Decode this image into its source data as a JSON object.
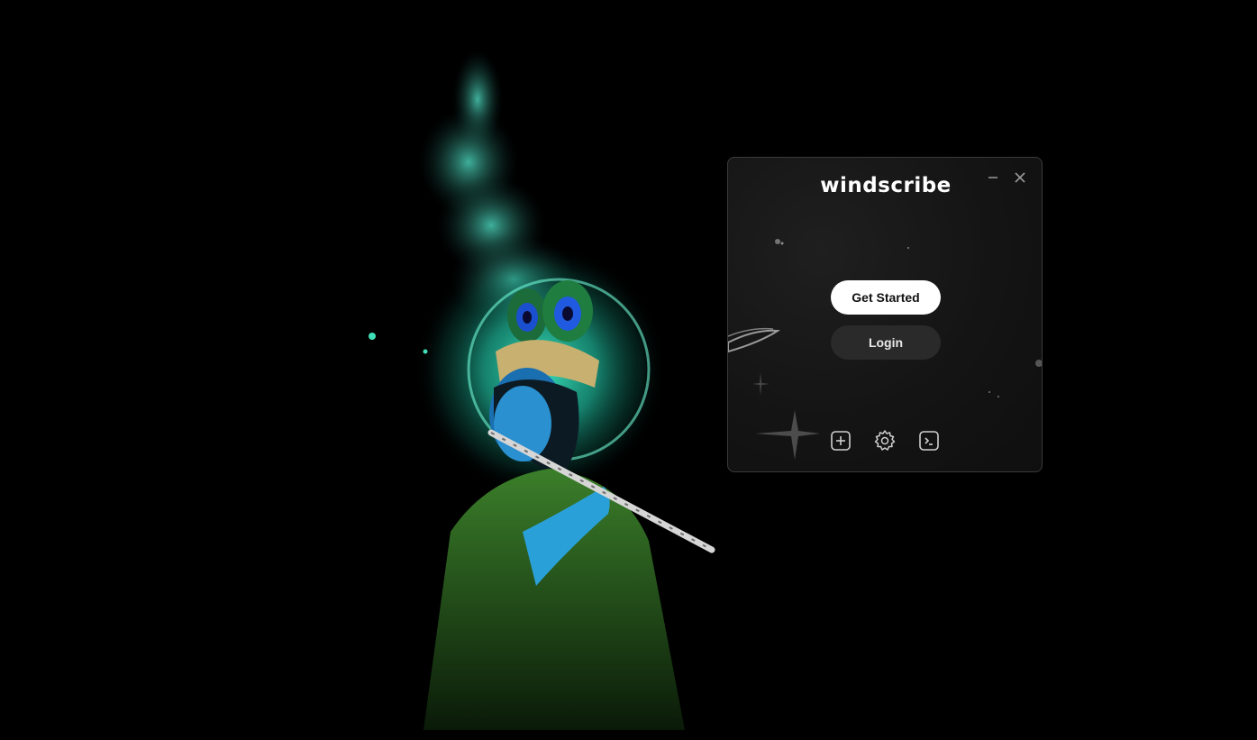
{
  "app": {
    "brand": "windscribe",
    "minimize_icon": "minimize-icon",
    "close_icon": "close-icon"
  },
  "actions": {
    "get_started_label": "Get Started",
    "login_label": "Login"
  },
  "bottom_bar": {
    "icons": [
      "add-location-icon",
      "settings-gear-icon",
      "terminal-icon"
    ]
  },
  "colors": {
    "window_bg": "#141414",
    "primary_button_bg": "#ffffff",
    "secondary_button_bg": "#2a2a2a",
    "wallpaper_glow": "#2fe0b8"
  }
}
